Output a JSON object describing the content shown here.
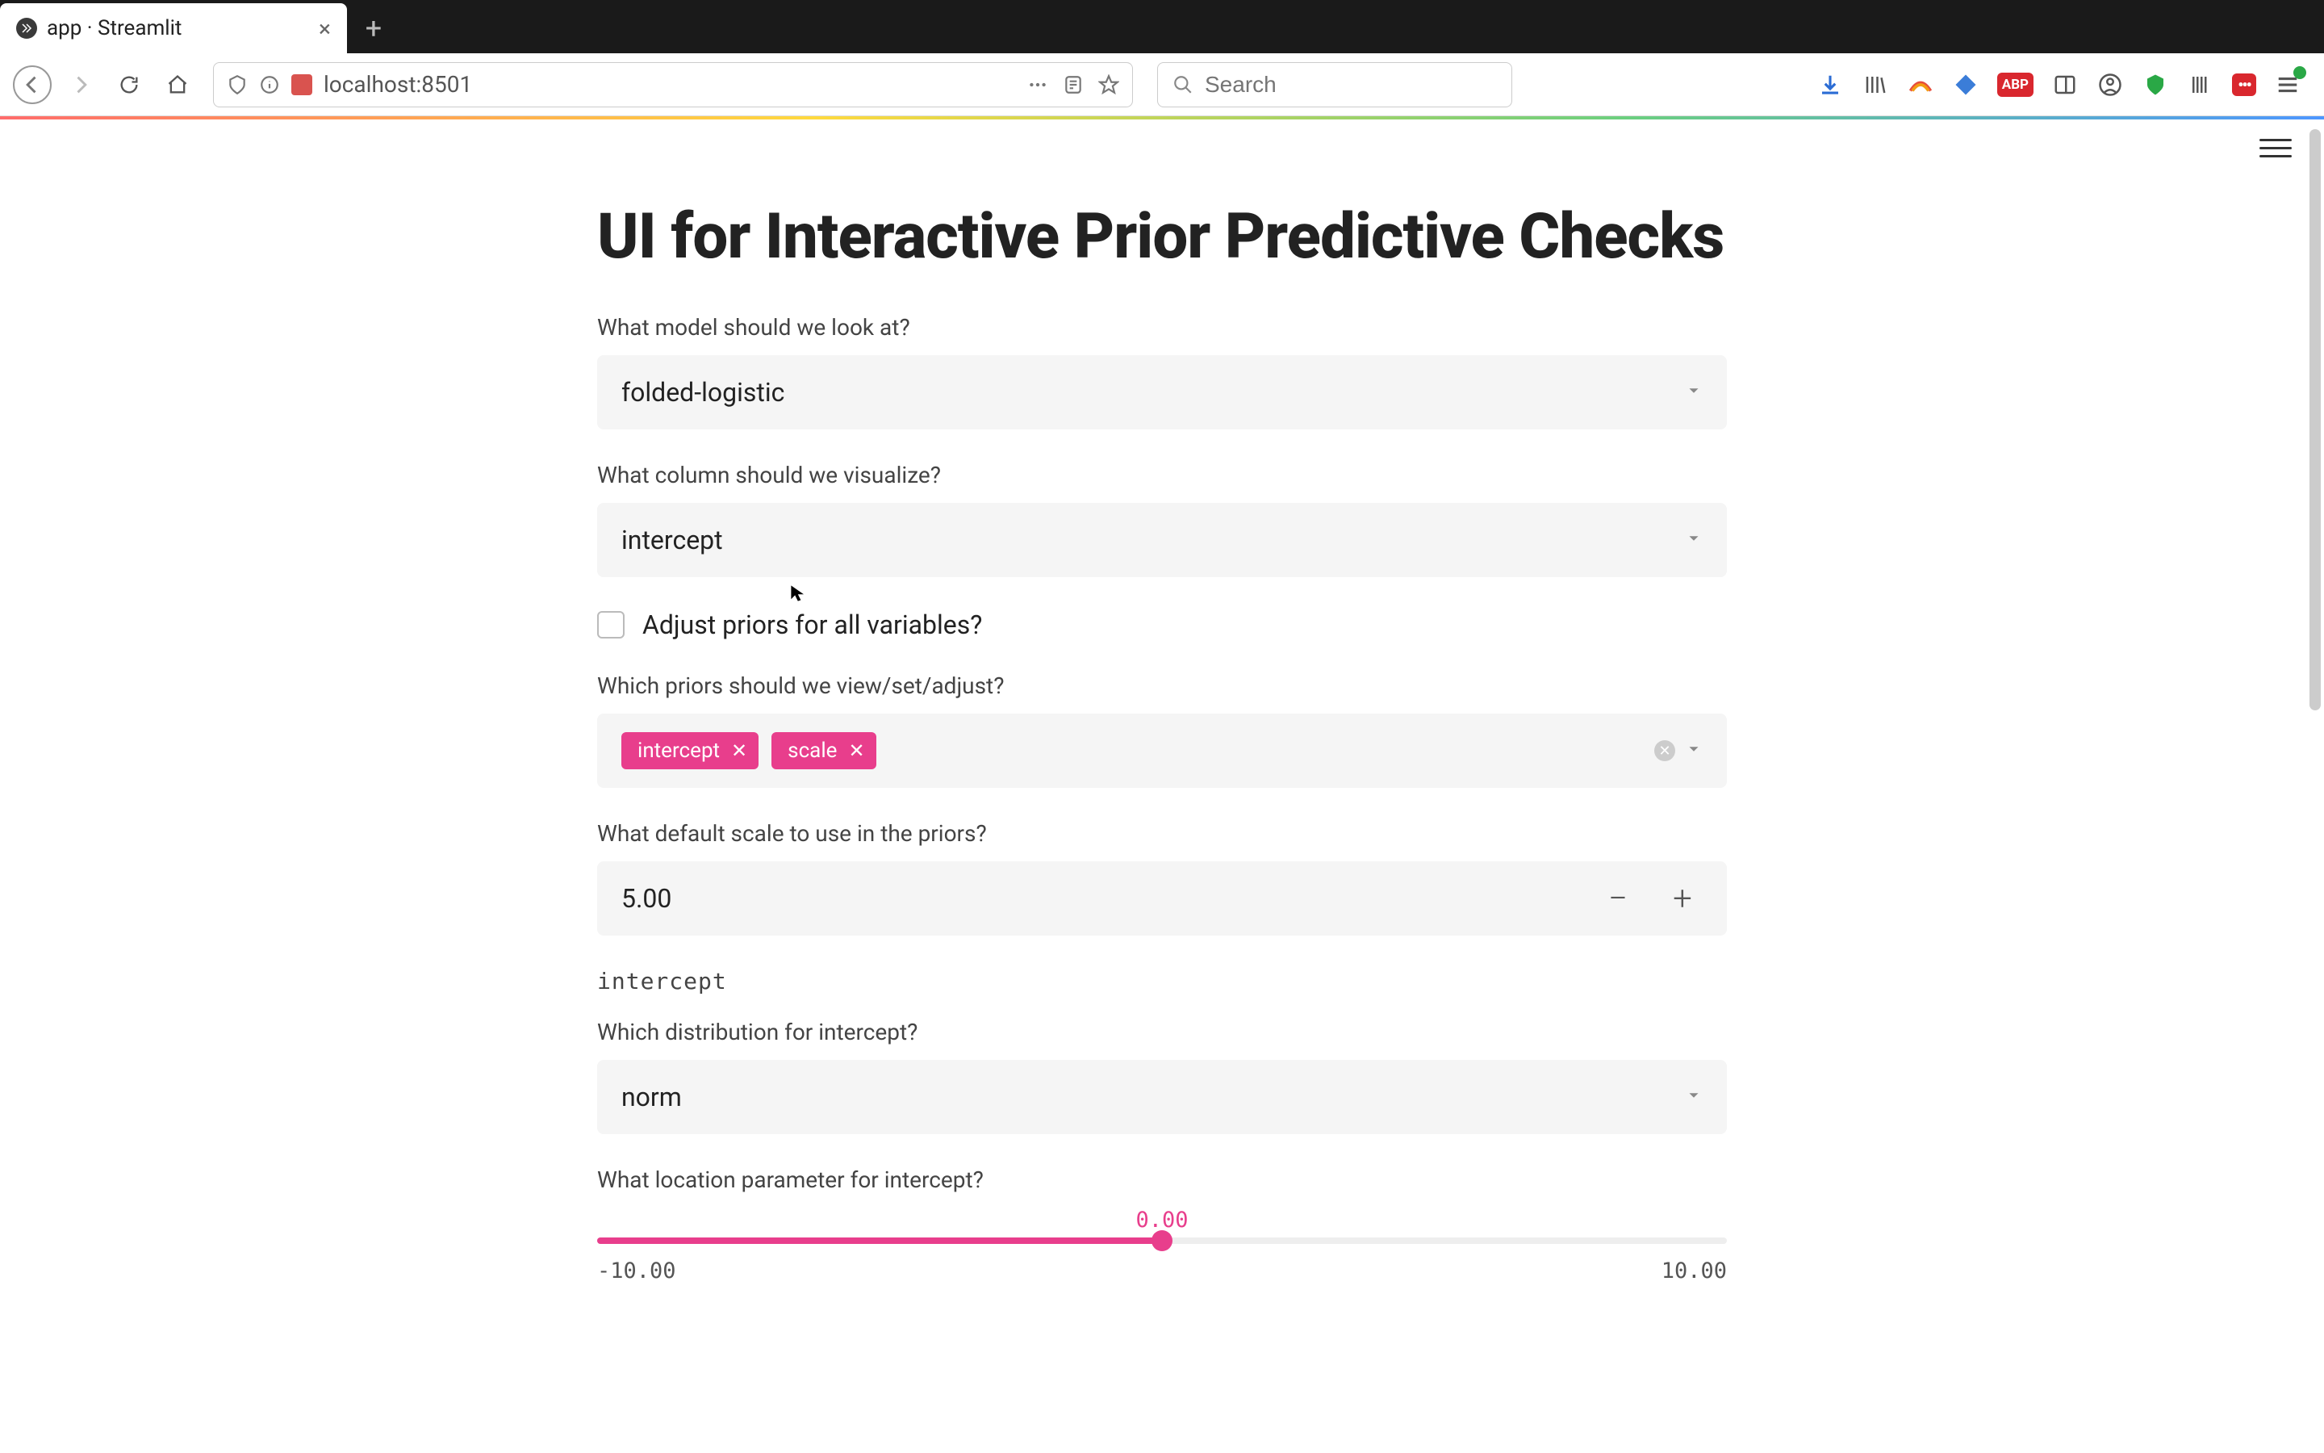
{
  "browser": {
    "tab_title": "app · Streamlit",
    "url": "localhost:8501",
    "search_placeholder": "Search"
  },
  "page": {
    "title": "UI for Interactive Prior Predictive Checks"
  },
  "fields": {
    "model_label": "What model should we look at?",
    "model_value": "folded-logistic",
    "column_label": "What column should we visualize?",
    "column_value": "intercept",
    "checkbox_label": "Adjust priors for all variables?",
    "priors_label": "Which priors should we view/set/adjust?",
    "priors_tags": [
      "intercept",
      "scale"
    ],
    "scale_label": "What default scale to use in the priors?",
    "scale_value": "5.00",
    "section_name": "intercept",
    "dist_label": "Which distribution for intercept?",
    "dist_value": "norm",
    "loc_label": "What location parameter for intercept?",
    "loc_value": "0.00",
    "loc_min": "-10.00",
    "loc_max": "10.00"
  }
}
